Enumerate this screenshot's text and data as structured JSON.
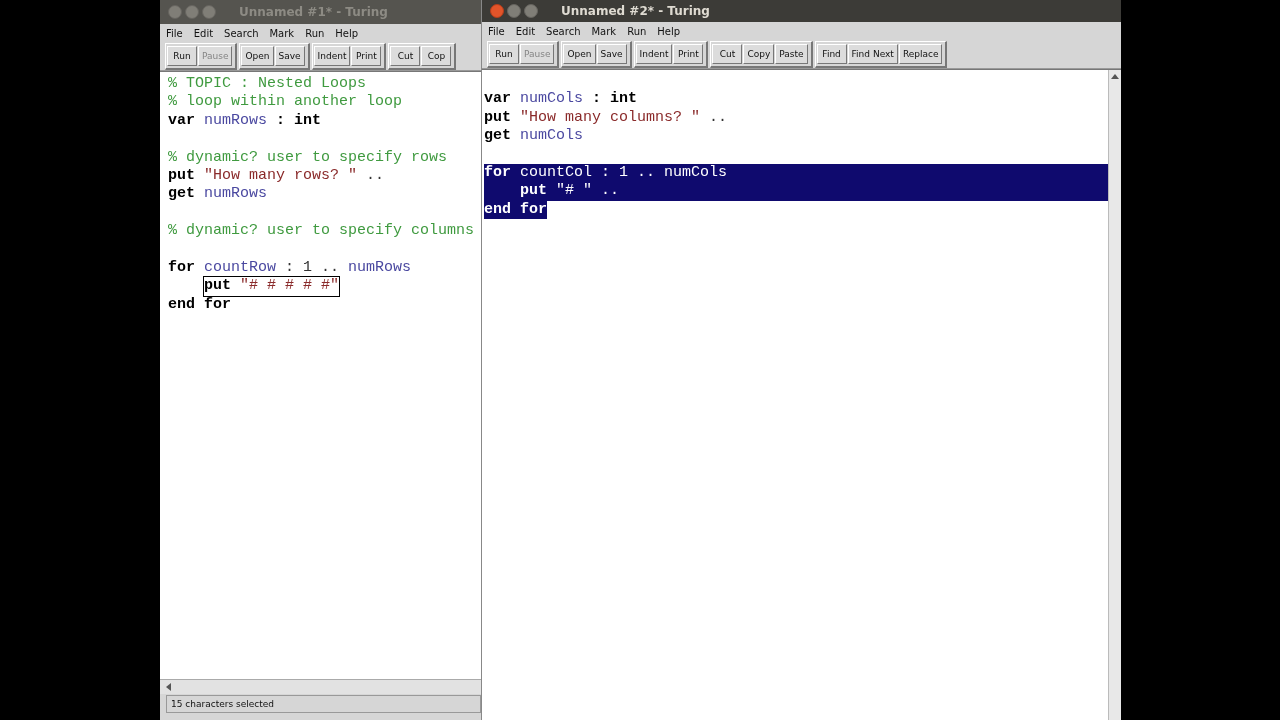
{
  "windows": [
    {
      "title": "Unnamed #1* - Turing",
      "active": false,
      "menu": [
        "File",
        "Edit",
        "Search",
        "Mark",
        "Run",
        "Help"
      ],
      "toolbar": [
        [
          {
            "label": "Run",
            "disabled": false
          },
          {
            "label": "Pause",
            "disabled": true
          }
        ],
        [
          {
            "label": "Open",
            "disabled": false
          },
          {
            "label": "Save",
            "disabled": false
          }
        ],
        [
          {
            "label": "Indent",
            "disabled": false
          },
          {
            "label": "Print",
            "disabled": false
          }
        ],
        [
          {
            "label": "Cut",
            "disabled": false
          },
          {
            "label": "Cop",
            "disabled": false
          }
        ]
      ],
      "lines": [
        {
          "tokens": [
            {
              "kind": "comment",
              "text": "% TOPIC : Nested Loops"
            }
          ]
        },
        {
          "tokens": [
            {
              "kind": "comment",
              "text": "% loop within another loop"
            }
          ]
        },
        {
          "tokens": [
            {
              "kind": "keyword",
              "text": "var"
            },
            {
              "kind": "ident",
              "text": "numRows"
            },
            {
              "kind": "keyword",
              "text": ": int"
            }
          ]
        },
        {
          "blank": true
        },
        {
          "tokens": [
            {
              "kind": "comment",
              "text": "% dynamic? user to specify rows"
            }
          ]
        },
        {
          "tokens": [
            {
              "kind": "keyword",
              "text": "put"
            },
            {
              "kind": "string",
              "text": "\"How many rows? \""
            },
            {
              "kind": "plain",
              "text": ".."
            }
          ]
        },
        {
          "tokens": [
            {
              "kind": "keyword",
              "text": "get"
            },
            {
              "kind": "ident",
              "text": "numRows"
            }
          ]
        },
        {
          "blank": true
        },
        {
          "tokens": [
            {
              "kind": "comment",
              "text": "% dynamic? user to specify columns"
            }
          ]
        },
        {
          "blank": true
        },
        {
          "tokens": [
            {
              "kind": "keyword",
              "text": "for"
            },
            {
              "kind": "ident",
              "text": "countRow"
            },
            {
              "kind": "plain",
              "text": ": 1 .."
            },
            {
              "kind": "ident",
              "text": "numRows"
            }
          ]
        },
        {
          "indent": true,
          "boxed": true,
          "tokens": [
            {
              "kind": "keyword",
              "text": "put"
            },
            {
              "kind": "string",
              "text": "\"# # # # #\""
            }
          ]
        },
        {
          "tokens": [
            {
              "kind": "keyword",
              "text": "end for"
            }
          ]
        }
      ],
      "status": "15 characters selected"
    },
    {
      "title": "Unnamed #2* - Turing",
      "active": true,
      "menu": [
        "File",
        "Edit",
        "Search",
        "Mark",
        "Run",
        "Help"
      ],
      "toolbar": [
        [
          {
            "label": "Run",
            "disabled": false
          },
          {
            "label": "Pause",
            "disabled": true
          }
        ],
        [
          {
            "label": "Open",
            "disabled": false
          },
          {
            "label": "Save",
            "disabled": false
          }
        ],
        [
          {
            "label": "Indent",
            "disabled": false
          },
          {
            "label": "Print",
            "disabled": false
          }
        ],
        [
          {
            "label": "Cut",
            "disabled": false
          },
          {
            "label": "Copy",
            "disabled": false
          },
          {
            "label": "Paste",
            "disabled": false
          }
        ],
        [
          {
            "label": "Find",
            "disabled": false
          },
          {
            "label": "Find Next",
            "disabled": false
          },
          {
            "label": "Replace",
            "disabled": false
          }
        ]
      ],
      "lines": [
        {
          "blank": true
        },
        {
          "tokens": [
            {
              "kind": "keyword",
              "text": "var"
            },
            {
              "kind": "ident",
              "text": "numCols"
            },
            {
              "kind": "keyword",
              "text": ": int"
            }
          ]
        },
        {
          "tokens": [
            {
              "kind": "keyword",
              "text": "put"
            },
            {
              "kind": "string",
              "text": "\"How many columns? \""
            },
            {
              "kind": "plain",
              "text": ".."
            }
          ]
        },
        {
          "tokens": [
            {
              "kind": "keyword",
              "text": "get"
            },
            {
              "kind": "ident",
              "text": "numCols"
            }
          ]
        },
        {
          "blank": true
        },
        {
          "selected": true,
          "tokens": [
            {
              "kind": "keyword",
              "text": "for"
            },
            {
              "kind": "ident",
              "text": "countCol"
            },
            {
              "kind": "plain",
              "text": ": 1 .."
            },
            {
              "kind": "ident",
              "text": "numCols"
            }
          ]
        },
        {
          "selected": true,
          "indent": true,
          "tokens": [
            {
              "kind": "keyword",
              "text": "put"
            },
            {
              "kind": "string",
              "text": "\"# \""
            },
            {
              "kind": "plain",
              "text": ".."
            }
          ]
        },
        {
          "selected": true,
          "tokens": [
            {
              "kind": "keyword",
              "text": "end for"
            }
          ]
        }
      ]
    }
  ]
}
